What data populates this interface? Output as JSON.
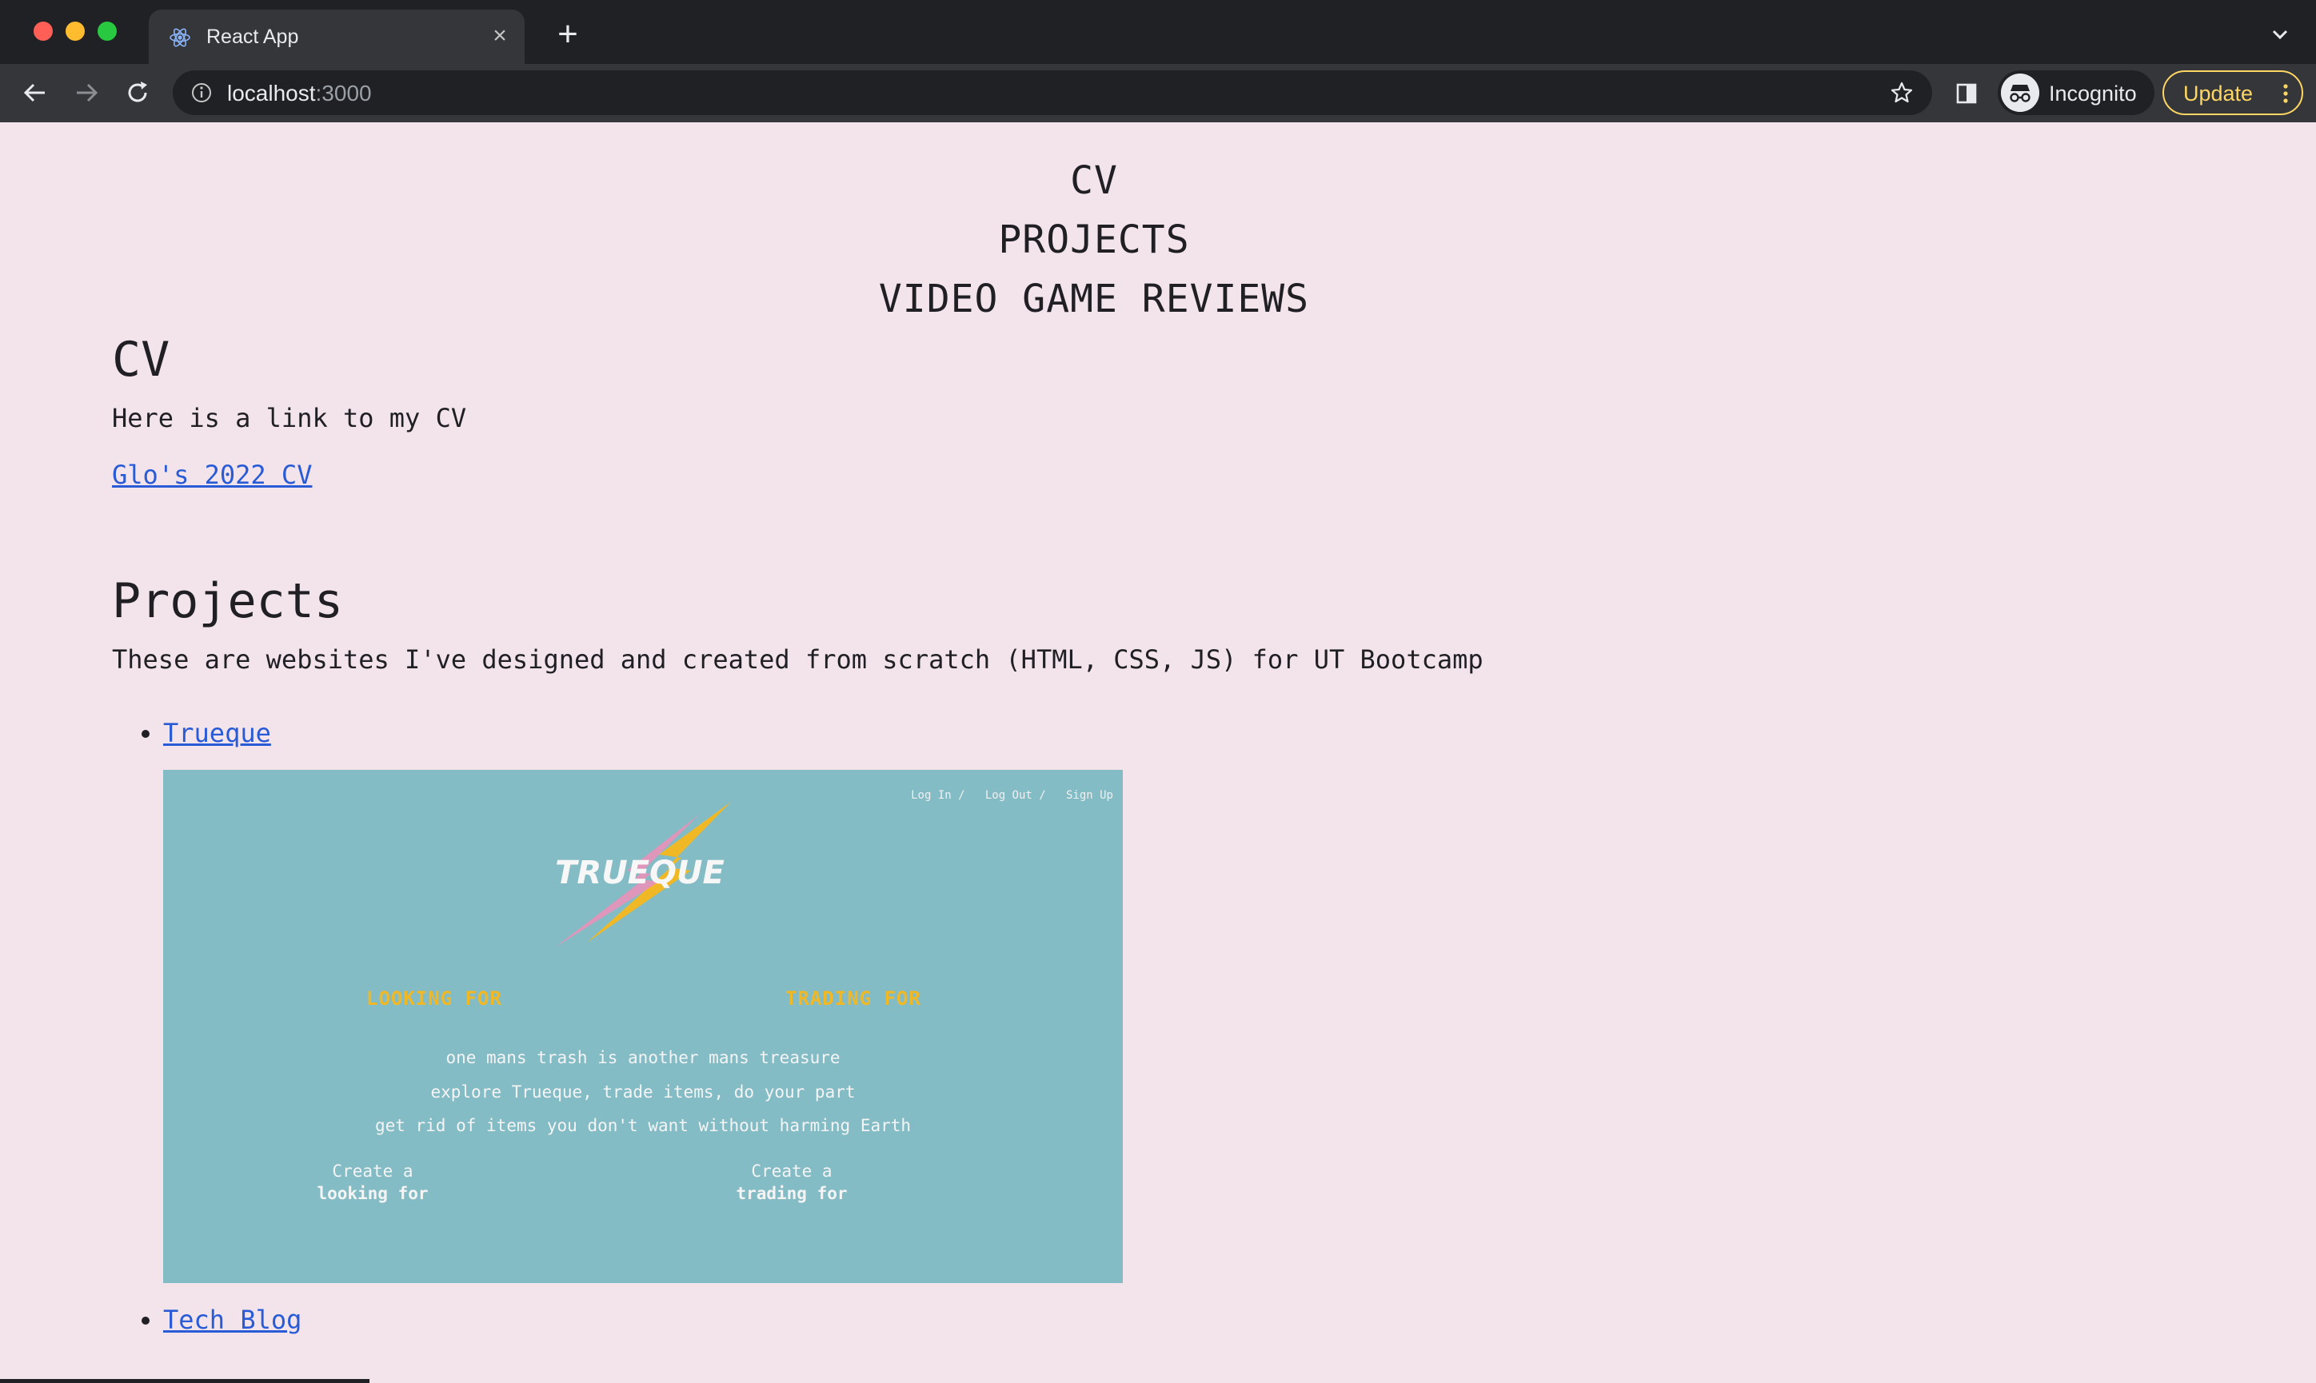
{
  "browser": {
    "tab_title": "React App",
    "url_host": "localhost",
    "url_port": ":3000",
    "profile_label": "Incognito",
    "update_label": "Update"
  },
  "nav": {
    "items": [
      "CV",
      "PROJECTS",
      "VIDEO GAME REVIEWS"
    ]
  },
  "cv": {
    "heading": "CV",
    "text": "Here is a link to my CV",
    "link_label": "Glo's 2022 CV"
  },
  "projects": {
    "heading": "Projects",
    "text": "These are websites I've designed and created from scratch (HTML, CSS, JS) for UT Bootcamp",
    "items": [
      {
        "label": "Trueque"
      },
      {
        "label": "Tech Blog"
      }
    ],
    "screenshot": {
      "top_links": "Log In /   Log Out /   Sign Up",
      "logo_text": "TRUEQUE",
      "heading_left": "LOOKING FOR",
      "heading_right": "TRADING FOR",
      "line1": "one mans trash is another mans treasure",
      "line2": "explore Trueque, trade items, do your part",
      "line3": "get rid of items you don't want without harming Earth",
      "cta_left_top": "Create a",
      "cta_left_bottom": "looking for",
      "cta_right_top": "Create a",
      "cta_right_bottom": "trading for"
    }
  },
  "colors": {
    "page_bg": "#f2e4ea",
    "link": "#2a5bd7",
    "screenshot_bg": "#84bcc6",
    "screenshot_heading": "#f1b825",
    "update_accent": "#fdd663"
  }
}
